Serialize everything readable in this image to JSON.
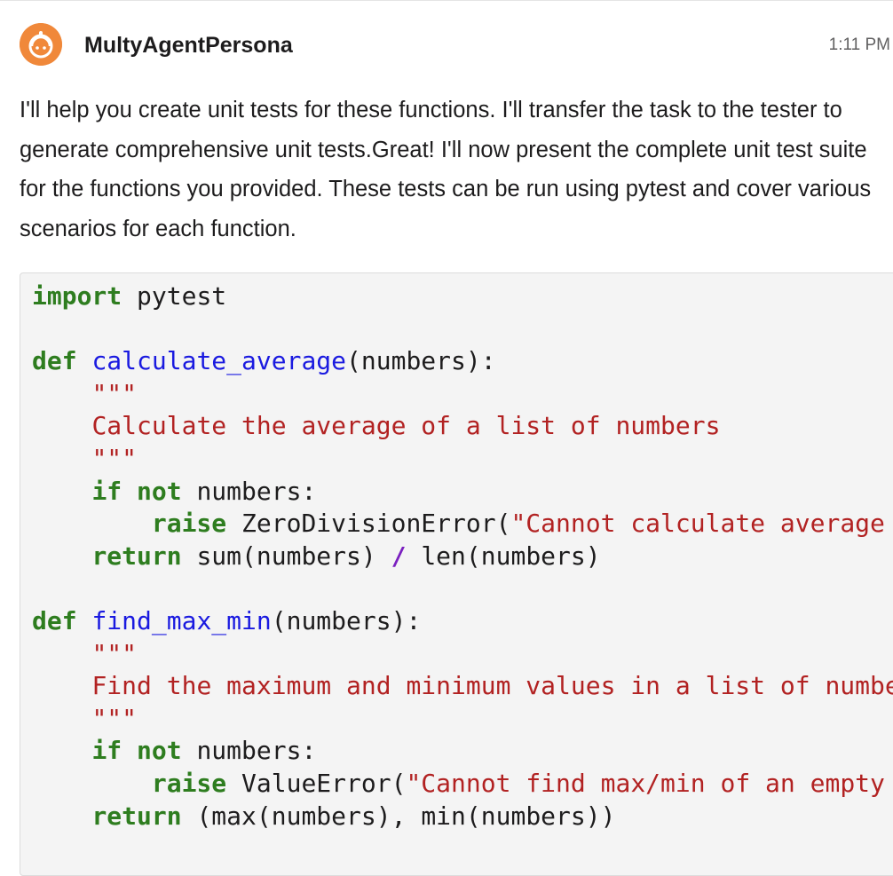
{
  "message": {
    "sender": "MultyAgentPersona",
    "time": "1:11 PM",
    "avatar_icon": "bot-avatar-icon",
    "avatar_color": "#f0883a",
    "text": "I'll help you create unit tests for these functions. I'll transfer the task to the tester to generate comprehensive unit tests.Great! I'll now present the complete unit test suite for the functions you provided. These tests can be run using pytest and cover various scenarios for each function."
  },
  "code": {
    "language": "python",
    "lines": [
      [
        {
          "t": "import",
          "c": "kw"
        },
        {
          "t": " pytest",
          "c": ""
        }
      ],
      [],
      [
        {
          "t": "def",
          "c": "kw"
        },
        {
          "t": " ",
          "c": ""
        },
        {
          "t": "calculate_average",
          "c": "fn"
        },
        {
          "t": "(numbers):",
          "c": ""
        }
      ],
      [
        {
          "t": "    ",
          "c": ""
        },
        {
          "t": "\"\"\"",
          "c": "str"
        }
      ],
      [
        {
          "t": "    ",
          "c": ""
        },
        {
          "t": "Calculate the average of a list of numbers",
          "c": "str"
        }
      ],
      [
        {
          "t": "    ",
          "c": ""
        },
        {
          "t": "\"\"\"",
          "c": "str"
        }
      ],
      [
        {
          "t": "    ",
          "c": ""
        },
        {
          "t": "if",
          "c": "kw"
        },
        {
          "t": " ",
          "c": ""
        },
        {
          "t": "not",
          "c": "kw"
        },
        {
          "t": " numbers:",
          "c": ""
        }
      ],
      [
        {
          "t": "        ",
          "c": ""
        },
        {
          "t": "raise",
          "c": "kw"
        },
        {
          "t": " ZeroDivisionError(",
          "c": ""
        },
        {
          "t": "\"Cannot calculate average of an empty list\"",
          "c": "str"
        },
        {
          "t": ")",
          "c": ""
        }
      ],
      [
        {
          "t": "    ",
          "c": ""
        },
        {
          "t": "return",
          "c": "kw"
        },
        {
          "t": " sum(numbers) ",
          "c": ""
        },
        {
          "t": "/",
          "c": "op"
        },
        {
          "t": " len(numbers)",
          "c": ""
        }
      ],
      [],
      [
        {
          "t": "def",
          "c": "kw"
        },
        {
          "t": " ",
          "c": ""
        },
        {
          "t": "find_max_min",
          "c": "fn"
        },
        {
          "t": "(numbers):",
          "c": ""
        }
      ],
      [
        {
          "t": "    ",
          "c": ""
        },
        {
          "t": "\"\"\"",
          "c": "str"
        }
      ],
      [
        {
          "t": "    ",
          "c": ""
        },
        {
          "t": "Find the maximum and minimum values in a list of numbers",
          "c": "str"
        }
      ],
      [
        {
          "t": "    ",
          "c": ""
        },
        {
          "t": "\"\"\"",
          "c": "str"
        }
      ],
      [
        {
          "t": "    ",
          "c": ""
        },
        {
          "t": "if",
          "c": "kw"
        },
        {
          "t": " ",
          "c": ""
        },
        {
          "t": "not",
          "c": "kw"
        },
        {
          "t": " numbers:",
          "c": ""
        }
      ],
      [
        {
          "t": "        ",
          "c": ""
        },
        {
          "t": "raise",
          "c": "kw"
        },
        {
          "t": " ValueError(",
          "c": ""
        },
        {
          "t": "\"Cannot find max/min of an empty list\"",
          "c": "str"
        },
        {
          "t": ")",
          "c": ""
        }
      ],
      [
        {
          "t": "    ",
          "c": ""
        },
        {
          "t": "return",
          "c": "kw"
        },
        {
          "t": " (max(numbers), min(numbers))",
          "c": ""
        }
      ]
    ]
  }
}
